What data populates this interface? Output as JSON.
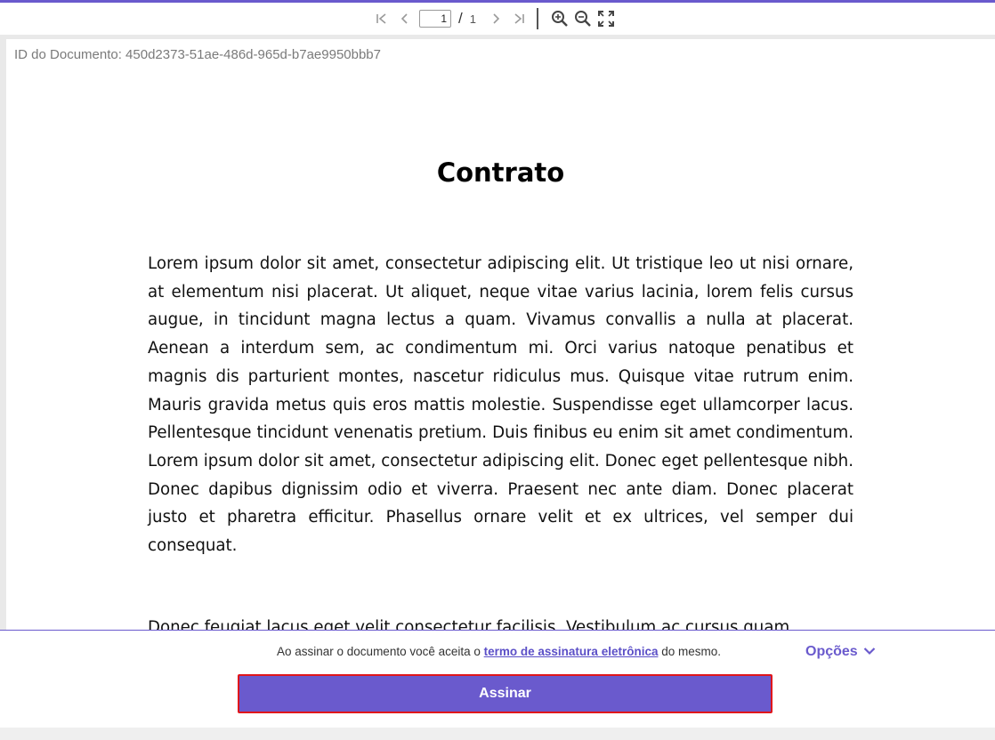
{
  "toolbar": {
    "current_page": "1",
    "page_separator": "/",
    "total_pages": "1",
    "icons": [
      "first-page-icon",
      "prev-page-icon",
      "next-page-icon",
      "last-page-icon",
      "zoom-in-icon",
      "zoom-out-icon",
      "fullscreen-icon"
    ]
  },
  "document": {
    "id_label": "ID do Documento: 450d2373-51ae-486d-965d-b7ae9950bbb7",
    "title": "Contrato",
    "paragraph1": "Lorem ipsum dolor sit amet, consectetur adipiscing elit. Ut tristique leo ut nisi ornare, at elementum nisi placerat. Ut aliquet, neque vitae varius lacinia, lorem felis cursus augue, in tincidunt magna lectus a quam. Vivamus convallis a nulla at placerat. Aenean a interdum sem, ac condimentum mi. Orci varius natoque penatibus et magnis dis parturient montes, nascetur ridiculus mus. Quisque vitae rutrum enim. Mauris gravida metus quis eros mattis molestie. Suspendisse eget ullamcorper lacus. Pellentesque tincidunt venenatis pretium. Duis finibus eu enim sit amet condimentum. Lorem ipsum dolor sit amet, consectetur adipiscing elit. Donec eget pellentesque nibh. Donec dapibus dignissim odio et viverra. Praesent nec ante diam. Donec placerat justo et pharetra efficitur. Phasellus ornare velit et ex ultrices, vel semper dui consequat.",
    "paragraph2": "Donec feugiat lacus eget velit consectetur facilisis. Vestibulum ac cursus quam."
  },
  "signing": {
    "terms_prefix": "Ao assinar o documento você aceita o ",
    "terms_link": "termo de assinatura eletrônica",
    "terms_suffix": " do mesmo.",
    "options_label": "Opções",
    "sign_button": "Assinar"
  },
  "colors": {
    "accent": "#6a5acd",
    "highlight_border": "#e0161b"
  }
}
